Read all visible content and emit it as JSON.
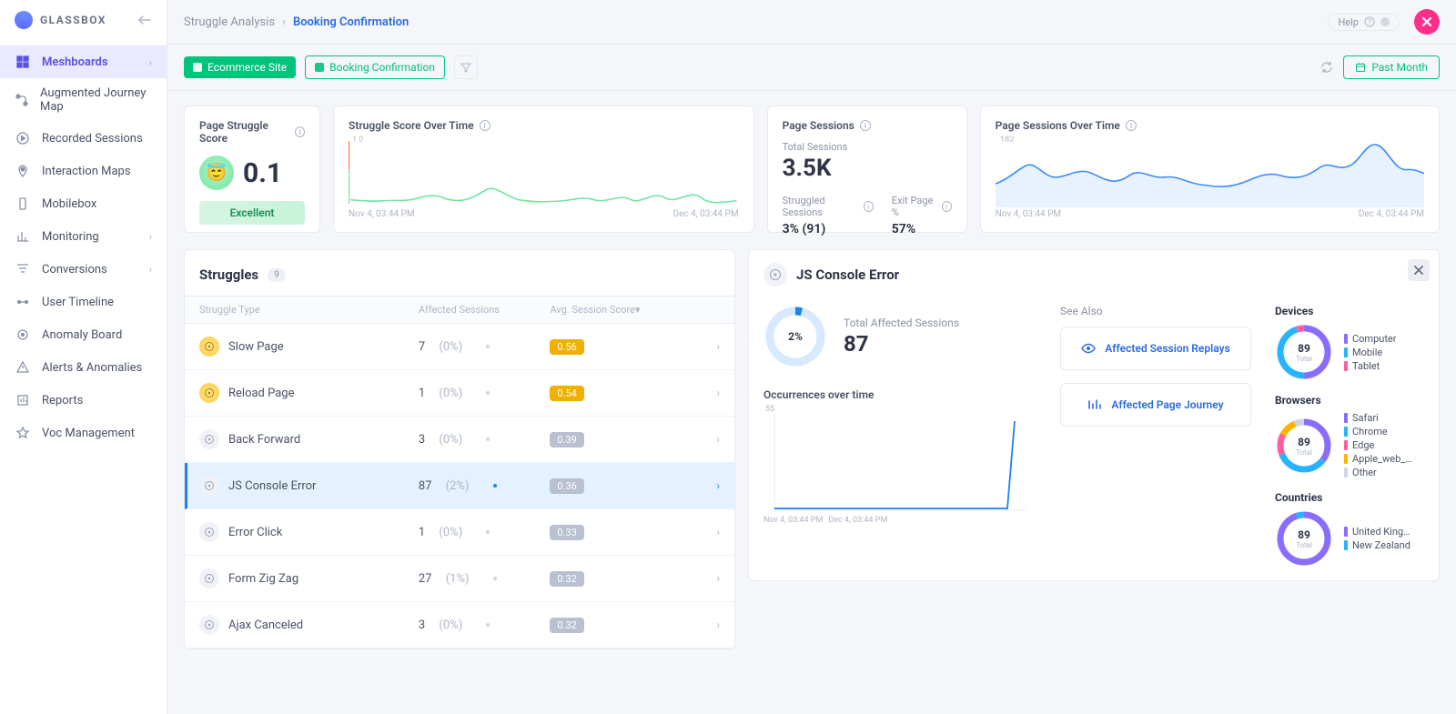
{
  "brand": "GLASSBOX",
  "sidebar": {
    "items": [
      {
        "label": "Meshboards",
        "icon": "grid",
        "chevron": true,
        "selected": true
      },
      {
        "label": "Augmented Journey Map",
        "icon": "flow"
      },
      {
        "label": "Recorded Sessions",
        "icon": "play"
      },
      {
        "label": "Interaction Maps",
        "icon": "pin"
      },
      {
        "label": "Mobilebox",
        "icon": "phone"
      },
      {
        "label": "Monitoring",
        "icon": "chart",
        "chevron": true
      },
      {
        "label": "Conversions",
        "icon": "funnel",
        "chevron": true
      },
      {
        "label": "User Timeline",
        "icon": "timeline"
      },
      {
        "label": "Anomaly Board",
        "icon": "target"
      },
      {
        "label": "Alerts & Anomalies",
        "icon": "alert"
      },
      {
        "label": "Reports",
        "icon": "report"
      },
      {
        "label": "Voc Management",
        "icon": "star"
      }
    ]
  },
  "breadcrumb": {
    "root": "Struggle Analysis",
    "current": "Booking Confirmation"
  },
  "topbar": {
    "help": "Help"
  },
  "filters": {
    "site": "Ecommerce Site",
    "page": "Booking Confirmation",
    "daterange": "Past Month"
  },
  "score": {
    "title": "Page Struggle Score",
    "value": "0.1",
    "badge": "Excellent"
  },
  "score_over_time": {
    "title": "Struggle Score Over Time",
    "ymax": "1.0",
    "start": "Nov 4, 03:44 PM",
    "end": "Dec 4, 03:44 PM"
  },
  "sessions": {
    "title": "Page Sessions",
    "total_label": "Total Sessions",
    "total": "3.5K",
    "struggled_label": "Struggled Sessions",
    "struggled": "3% (91)",
    "exit_label": "Exit Page %",
    "exit": "57%"
  },
  "sessions_over_time": {
    "title": "Page Sessions Over Time",
    "ymax": "182",
    "start": "Nov 4, 03:44 PM",
    "end": "Dec 4, 03:44 PM"
  },
  "struggles": {
    "title": "Struggles",
    "count": "9",
    "columns": {
      "type": "Struggle Type",
      "sessions": "Affected Sessions",
      "score": "Avg. Session Score"
    },
    "rows": [
      {
        "name": "Slow Page",
        "icon": "gold",
        "n": "7",
        "pct": "(0%)",
        "score": "0.56",
        "chip": "y"
      },
      {
        "name": "Reload Page",
        "icon": "gold",
        "n": "1",
        "pct": "(0%)",
        "score": "0.54",
        "chip": "y"
      },
      {
        "name": "Back Forward",
        "icon": "grey",
        "n": "3",
        "pct": "(0%)",
        "score": "0.39",
        "chip": "g"
      },
      {
        "name": "JS Console Error",
        "icon": "grey",
        "n": "87",
        "pct": "(2%)",
        "score": "0.36",
        "chip": "g",
        "selected": true,
        "dot": "blue"
      },
      {
        "name": "Error Click",
        "icon": "grey",
        "n": "1",
        "pct": "(0%)",
        "score": "0.33",
        "chip": "g"
      },
      {
        "name": "Form Zig Zag",
        "icon": "grey",
        "n": "27",
        "pct": "(1%)",
        "score": "0.32",
        "chip": "g"
      },
      {
        "name": "Ajax Canceled",
        "icon": "grey",
        "n": "3",
        "pct": "(0%)",
        "score": "0.32",
        "chip": "g"
      }
    ]
  },
  "detail": {
    "title": "JS Console Error",
    "donut_pct": "2%",
    "affected_label": "Total Affected Sessions",
    "affected": "87",
    "occ_title": "Occurrences over time",
    "occ_y": "55",
    "occ_start": "Nov 4, 03:44 PM",
    "occ_end": "Dec 4, 03:44 PM",
    "see_also": "See Also",
    "link1": "Affected Session Replays",
    "link2": "Affected Page Journey",
    "donuts": {
      "devices": {
        "title": "Devices",
        "center": "89",
        "sub": "Total",
        "legend": [
          "Computer",
          "Mobile",
          "Tablet"
        ],
        "colors": [
          "#8a6cff",
          "#27b4ff",
          "#ff5da2"
        ]
      },
      "browsers": {
        "title": "Browsers",
        "center": "89",
        "sub": "Total",
        "legend": [
          "Safari",
          "Chrome",
          "Edge",
          "Apple_web_…",
          "Other"
        ],
        "colors": [
          "#8a6cff",
          "#27b4ff",
          "#ff5da2",
          "#ffb400",
          "#cfd5e3"
        ]
      },
      "countries": {
        "title": "Countries",
        "center": "89",
        "sub": "Total",
        "legend": [
          "United King…",
          "New Zealand"
        ],
        "colors": [
          "#8a6cff",
          "#27b4ff"
        ]
      }
    }
  },
  "chart_data": [
    {
      "type": "line",
      "title": "Struggle Score Over Time",
      "ylim": [
        0,
        1.0
      ],
      "x_start": "Nov 4, 03:44 PM",
      "x_end": "Dec 4, 03:44 PM",
      "values": [
        0.08,
        0.07,
        0.06,
        0.07,
        0.06,
        0.07,
        0.12,
        0.1,
        0.08,
        0.14,
        0.1,
        0.07,
        0.06,
        0.06,
        0.07,
        0.09,
        0.08,
        0.1,
        0.07,
        0.08,
        0.12,
        0.09,
        0.13,
        0.08,
        0.12,
        0.07,
        0.08,
        0.07,
        0.06,
        0.07,
        0.06
      ]
    },
    {
      "type": "area",
      "title": "Page Sessions Over Time",
      "ylim": [
        0,
        182
      ],
      "x_start": "Nov 4, 03:44 PM",
      "x_end": "Dec 4, 03:44 PM",
      "values": [
        80,
        95,
        120,
        90,
        85,
        100,
        95,
        75,
        115,
        100,
        90,
        95,
        85,
        80,
        85,
        75,
        80,
        70,
        90,
        100,
        95,
        110,
        100,
        90,
        100,
        115,
        180,
        125,
        100,
        95,
        100
      ]
    },
    {
      "type": "line",
      "title": "Occurrences over time",
      "ylim": [
        0,
        55
      ],
      "x_start": "Nov 4, 03:44 PM",
      "x_end": "Dec 4, 03:44 PM",
      "values": [
        0,
        0,
        0,
        0,
        0,
        0,
        0,
        0,
        0,
        0,
        0,
        0,
        0,
        0,
        0,
        0,
        0,
        0,
        0,
        0,
        0,
        0,
        0,
        0,
        0,
        0,
        0,
        0,
        0,
        0,
        55
      ]
    },
    {
      "type": "pie",
      "title": "Total Affected Sessions",
      "values": {
        "affected": 2,
        "other": 98
      }
    },
    {
      "type": "pie",
      "title": "Devices",
      "total": 89,
      "series": [
        {
          "name": "Computer",
          "value": 45
        },
        {
          "name": "Mobile",
          "value": 40
        },
        {
          "name": "Tablet",
          "value": 4
        }
      ]
    },
    {
      "type": "pie",
      "title": "Browsers",
      "total": 89,
      "series": [
        {
          "name": "Safari",
          "value": 32
        },
        {
          "name": "Chrome",
          "value": 30
        },
        {
          "name": "Edge",
          "value": 12
        },
        {
          "name": "Apple_web_",
          "value": 10
        },
        {
          "name": "Other",
          "value": 5
        }
      ]
    },
    {
      "type": "pie",
      "title": "Countries",
      "total": 89,
      "series": [
        {
          "name": "United Kingdom",
          "value": 85
        },
        {
          "name": "New Zealand",
          "value": 4
        }
      ]
    }
  ]
}
